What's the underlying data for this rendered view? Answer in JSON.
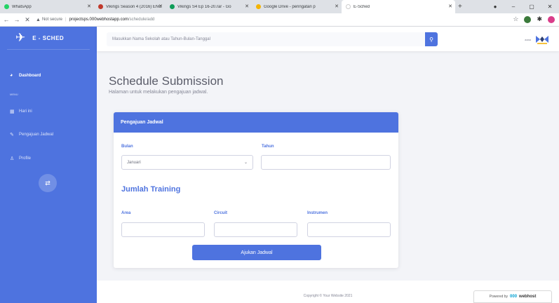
{
  "browser": {
    "tabs": [
      {
        "title": "WhatsApp",
        "color": "#25d366"
      },
      {
        "title": "Vikings Season 4 (2016) ENG",
        "color": "#c0392b"
      },
      {
        "title": "Vikings S4 Ep 16-20.rar - Go",
        "color": "#0f9d58"
      },
      {
        "title": "Google Drive - peringatan p",
        "color": "#f4b400"
      },
      {
        "title": "E-Sched",
        "color": "#ffffff"
      }
    ],
    "security_label": "Not secure",
    "url_host": "projectsps.000webhostapp.com",
    "url_path": "/schedule/add"
  },
  "app": {
    "brand": "E - SCHED",
    "search_placeholder": "Masukkan Nama Sekolah atau Tahun-Bulan-Tanggal",
    "user_name": "aaaa"
  },
  "sidebar": {
    "dashboard": "Dashboard",
    "heading": "MENU",
    "items": [
      "Hari ini",
      "Pengajuan Jadwal",
      "Profile"
    ]
  },
  "page": {
    "title": "Schedule Submission",
    "subtitle": "Halaman untuk melakukan pengajuan jadwal."
  },
  "form": {
    "card_title": "Pengajuan Jadwal",
    "bulan_label": "Bulan",
    "bulan_value": "Januari",
    "tahun_label": "Tahun",
    "tahun_value": "",
    "section_title": "Jumlah Training",
    "area_label": "Area",
    "circuit_label": "Circuit",
    "instrumen_label": "Instrumen",
    "submit_label": "Ajukan Jadwal"
  },
  "footer": {
    "copyright": "Copyright © Your Website 2021",
    "powered_by": "Powered by",
    "host_brand_a": "000",
    "host_brand_b": "webhost"
  },
  "colors": {
    "primary": "#4e73df",
    "page_bg": "#f3f4f8"
  }
}
